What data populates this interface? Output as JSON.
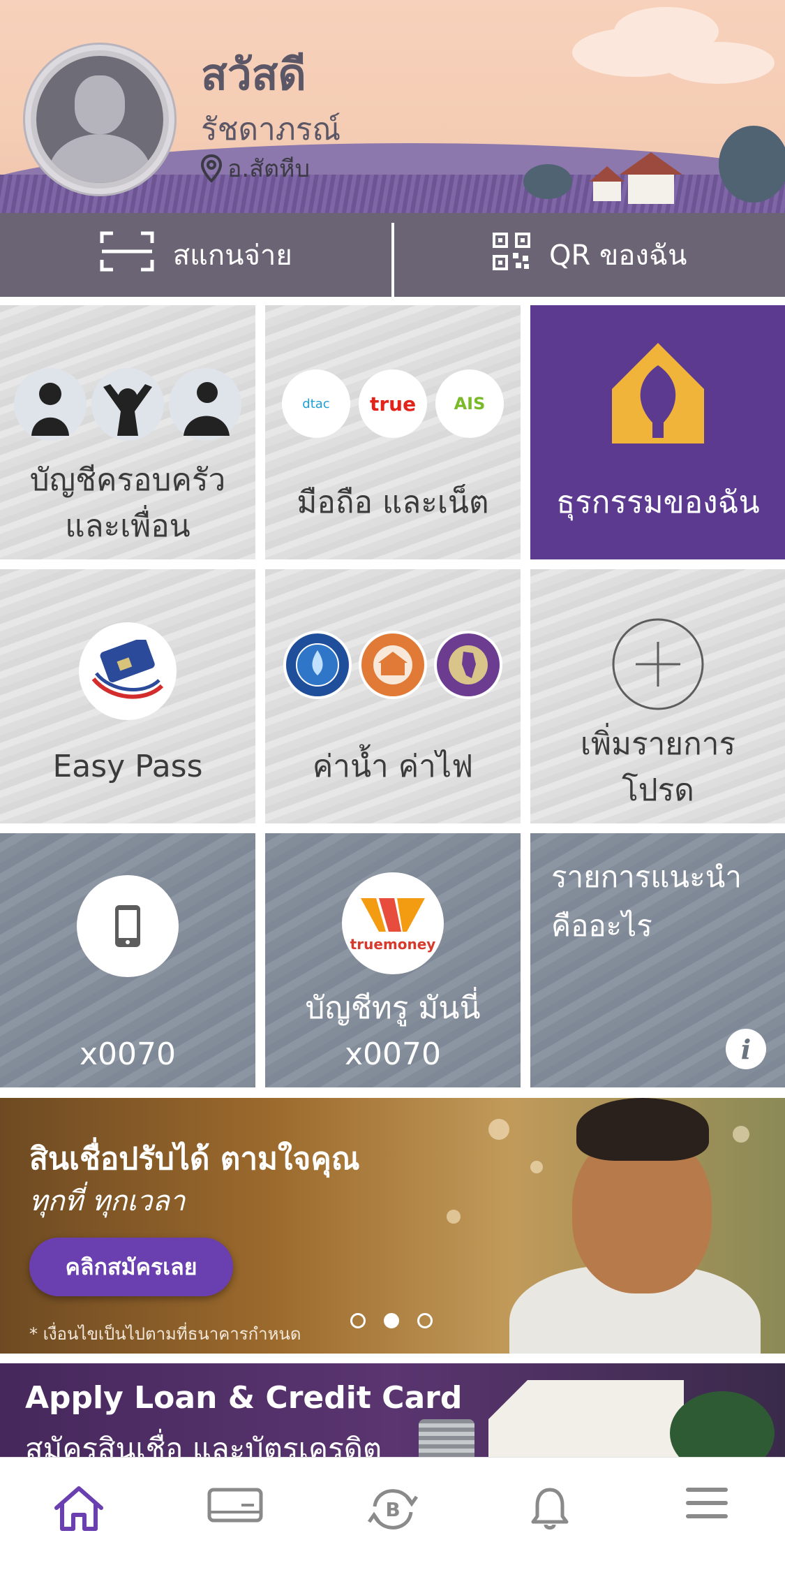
{
  "profile": {
    "greeting": "สวัสดี",
    "name": "รัชดาภรณ์",
    "location": "อ.สัตหีบ",
    "avatar_icon": "default-avatar-silhouette"
  },
  "actions": {
    "scan_label": "สแกนจ่าย",
    "scan_icon": "scan-frame-icon",
    "qr_label": "QR ของฉัน",
    "qr_icon": "qr-code-icon"
  },
  "tiles": {
    "family": {
      "label_line1": "บัญชีครอบครัว",
      "label_line2": "และเพื่อน"
    },
    "mobile": {
      "label": "มือถือ และเน็ต",
      "logos": {
        "dtac": "dtac",
        "true": "true",
        "ais": "AIS"
      }
    },
    "transactions": {
      "label": "ธุรกรรมของฉัน",
      "icon": "scb-logo-icon",
      "color": "#5b3a8f",
      "icon_color": "#f0b43a"
    },
    "easypass": {
      "label": "Easy Pass"
    },
    "utilities": {
      "label": "ค่าน้ำ ค่าไฟ"
    },
    "add_favorite": {
      "label_line1": "เพิ่มรายการ",
      "label_line2": "โปรด"
    },
    "phone_account": {
      "label": "x0070"
    },
    "truemoney": {
      "label_line1": "บัญชีทรู มันนี่",
      "label_line2": "x0070",
      "logo_text": "truemoney"
    },
    "recommend": {
      "label_line1": "รายการแนะนำ",
      "label_line2": "คืออะไร",
      "info_icon": "i"
    }
  },
  "banner_promo": {
    "title": "สินเชื่อปรับได้ ตามใจคุณ",
    "subtitle": "ทุกที่ ทุกเวลา",
    "button_label": "คลิกสมัครเลย",
    "note": "* เงื่อนไขเป็นไปตามที่ธนาคารกำหนด",
    "active_dot": 2,
    "dot_count": 3
  },
  "banner_loan": {
    "title": "Apply Loan & Credit Card",
    "subtitle": "สมัครสินเชื่อ และบัตรเครดิต"
  },
  "nav": {
    "items": [
      "home-icon",
      "card-icon",
      "bitcoin-exchange-icon",
      "bell-icon",
      "menu-icon"
    ],
    "active": "home-icon",
    "active_color": "#6a3fb0",
    "inactive_color": "#8a8a8a"
  }
}
